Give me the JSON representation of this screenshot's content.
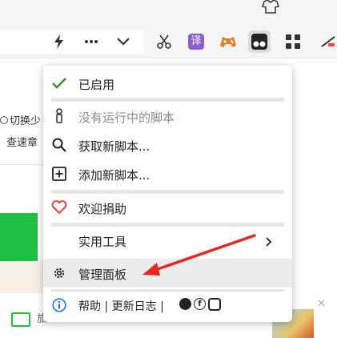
{
  "sidebar": {
    "switch_text": "切换少",
    "check_text": "查速章",
    "row_text": "旅"
  },
  "colors": {
    "green": "#1fbf45",
    "menu_check": "#3a8a2e",
    "heart": "#e0443c",
    "info": "#1a73e8",
    "annotation_red": "#e8281e",
    "tamper_bg": "#222222"
  },
  "menu": {
    "enabled": "已启用",
    "no_scripts": "没有运行中的脚本",
    "get_scripts": "获取新脚本...",
    "add_script": "添加新脚本...",
    "donate": "欢迎捐助",
    "utilities": "实用工具",
    "dashboard": "管理面板",
    "footer_help": "帮助",
    "footer_sep1": "|",
    "footer_changelog": "更新日志",
    "footer_sep2": "|"
  },
  "toolbar": {
    "translate_glyph": "译",
    "more_glyph": "•••"
  }
}
